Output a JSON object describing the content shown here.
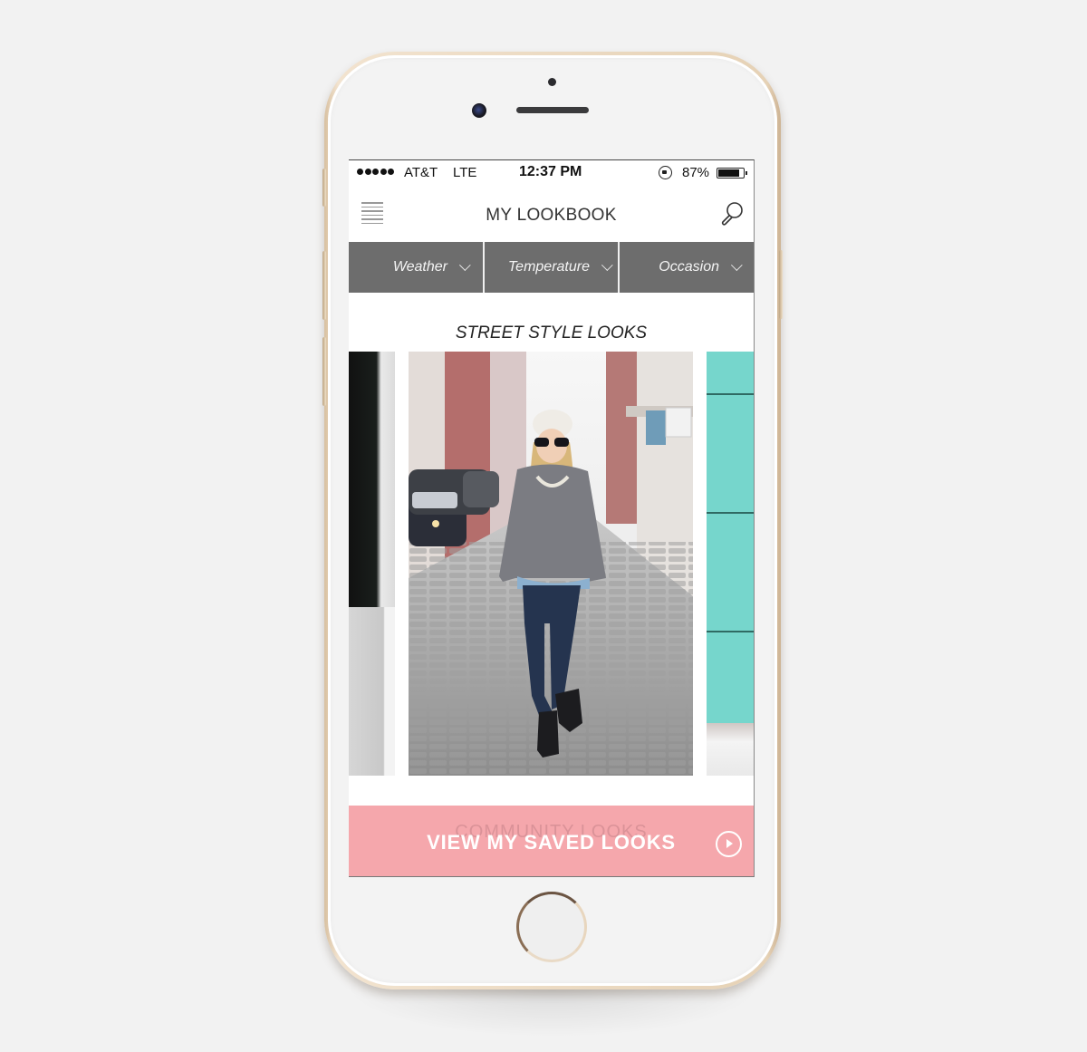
{
  "status_bar": {
    "signal_bars": 5,
    "carrier": "AT&T",
    "network": "LTE",
    "time": "12:37 PM",
    "orientation_lock_icon": "rotation-lock-icon",
    "battery_percent": "87%",
    "battery_level": 0.87
  },
  "nav": {
    "menu_icon": "hamburger-menu-icon",
    "title": "MY LOOKBOOK",
    "search_icon": "search-icon"
  },
  "filters": [
    {
      "label": "Weather",
      "icon": "chevron-down-icon"
    },
    {
      "label": "Temperature",
      "icon": "chevron-down-icon"
    },
    {
      "label": "Occasion",
      "icon": "chevron-down-icon"
    }
  ],
  "section": {
    "title": "STREET STYLE LOOKS"
  },
  "carousel": {
    "items": [
      {
        "description": "Partial look: dark door and white wall (previous)"
      },
      {
        "description": "Woman in white beanie, sunglasses, grey sweater, chambray shirt, dark jeans and black ankle boots on snowy cobblestone street"
      },
      {
        "description": "Partial look: turquoise wall (next)"
      }
    ]
  },
  "cta": {
    "ghost_label": "COMMUNITY LOOKS",
    "label": "VIEW MY SAVED LOOKS",
    "icon": "play-circle-icon"
  },
  "colors": {
    "filter_bar": "#6d6d6d",
    "cta_background": "#f5a7ac",
    "phone_frame": "#e6d2b6"
  }
}
